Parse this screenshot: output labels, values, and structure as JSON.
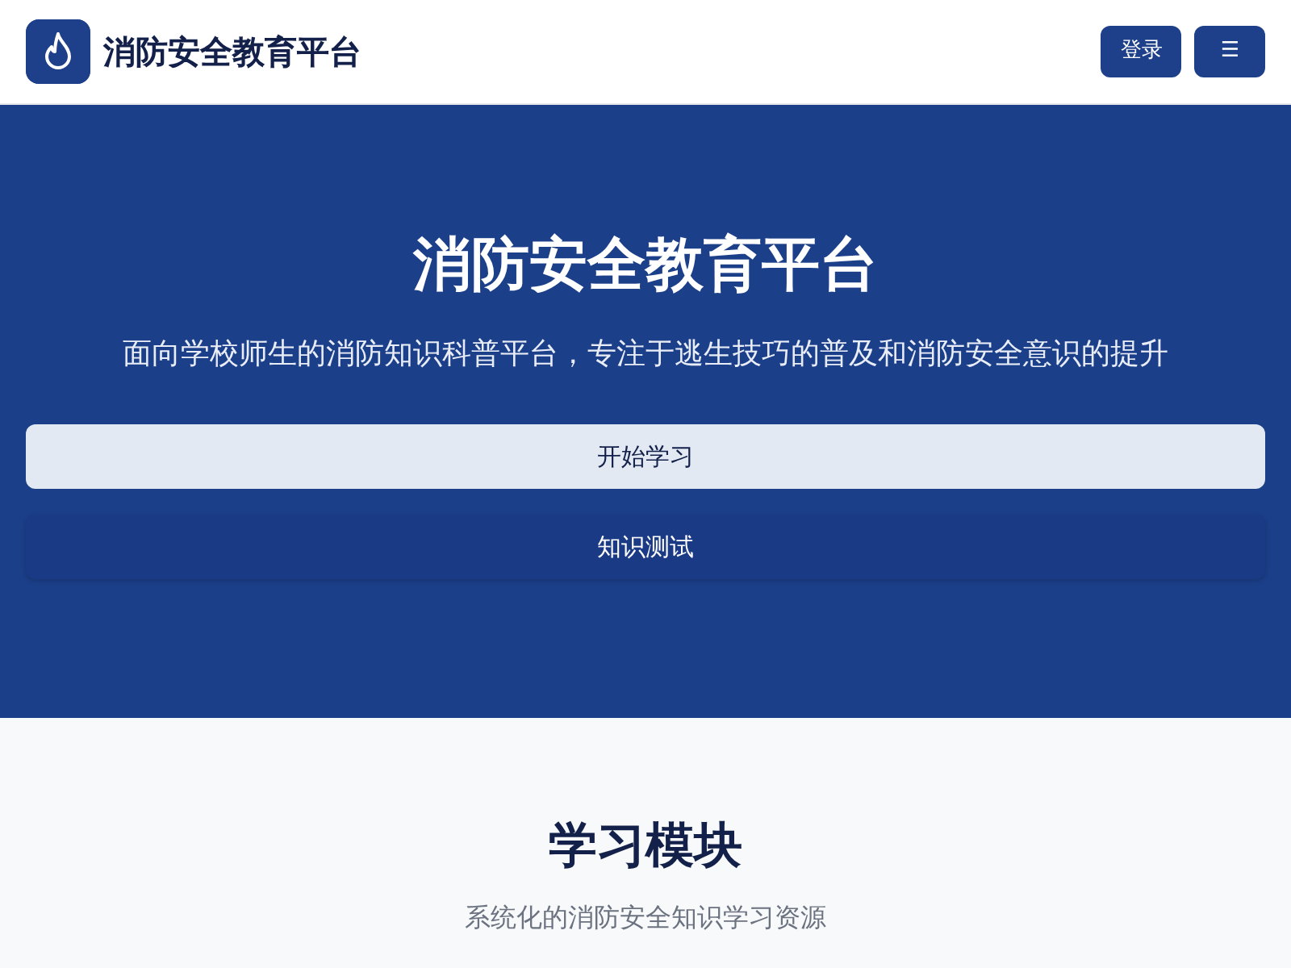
{
  "header": {
    "brand": "消防安全教育平台",
    "login": "登录",
    "menu": "☰"
  },
  "hero": {
    "title": "消防安全教育平台",
    "subtitle": "面向学校师生的消防知识科普平台，专注于逃生技巧的普及和消防安全意识的提升",
    "buttons": [
      {
        "label": "开始学习",
        "kind": "primary"
      },
      {
        "label": "知识测试",
        "kind": "secondary"
      }
    ]
  },
  "section": {
    "title": "学习模块",
    "subtitle": "系统化的消防安全知识学习资源"
  }
}
